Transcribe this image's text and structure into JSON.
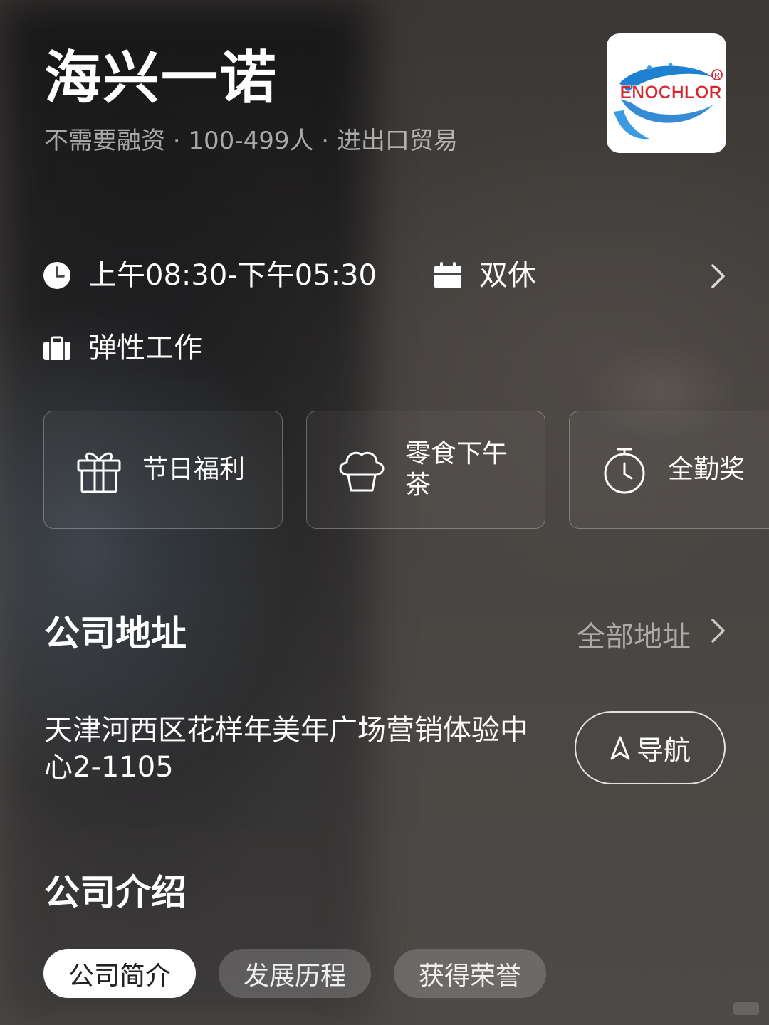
{
  "header": {
    "company_name": "海兴一诺",
    "meta": "不需要融资 · 100-499人 · 进出口贸易",
    "logo_text": "ENOCHLOR"
  },
  "schedule": {
    "hours": "上午08:30-下午05:30",
    "rest": "双休",
    "work_style": "弹性工作"
  },
  "benefits": [
    {
      "label": "节日福利",
      "icon": "gift-icon"
    },
    {
      "label": "零食下午茶",
      "icon": "cupcake-icon"
    },
    {
      "label": "全勤奖",
      "icon": "stopwatch-icon"
    }
  ],
  "address_section": {
    "title": "公司地址",
    "all_link": "全部地址",
    "address": "天津河西区花样年美年广场营销体验中心2-1105",
    "nav_button": "导航"
  },
  "intro_section": {
    "title": "公司介绍",
    "tabs": [
      {
        "label": "公司简介",
        "active": true
      },
      {
        "label": "发展历程",
        "active": false
      },
      {
        "label": "获得荣誉",
        "active": false
      }
    ]
  },
  "colors": {
    "logo_red": "#d8262c",
    "logo_blue": "#1f7fd0"
  }
}
